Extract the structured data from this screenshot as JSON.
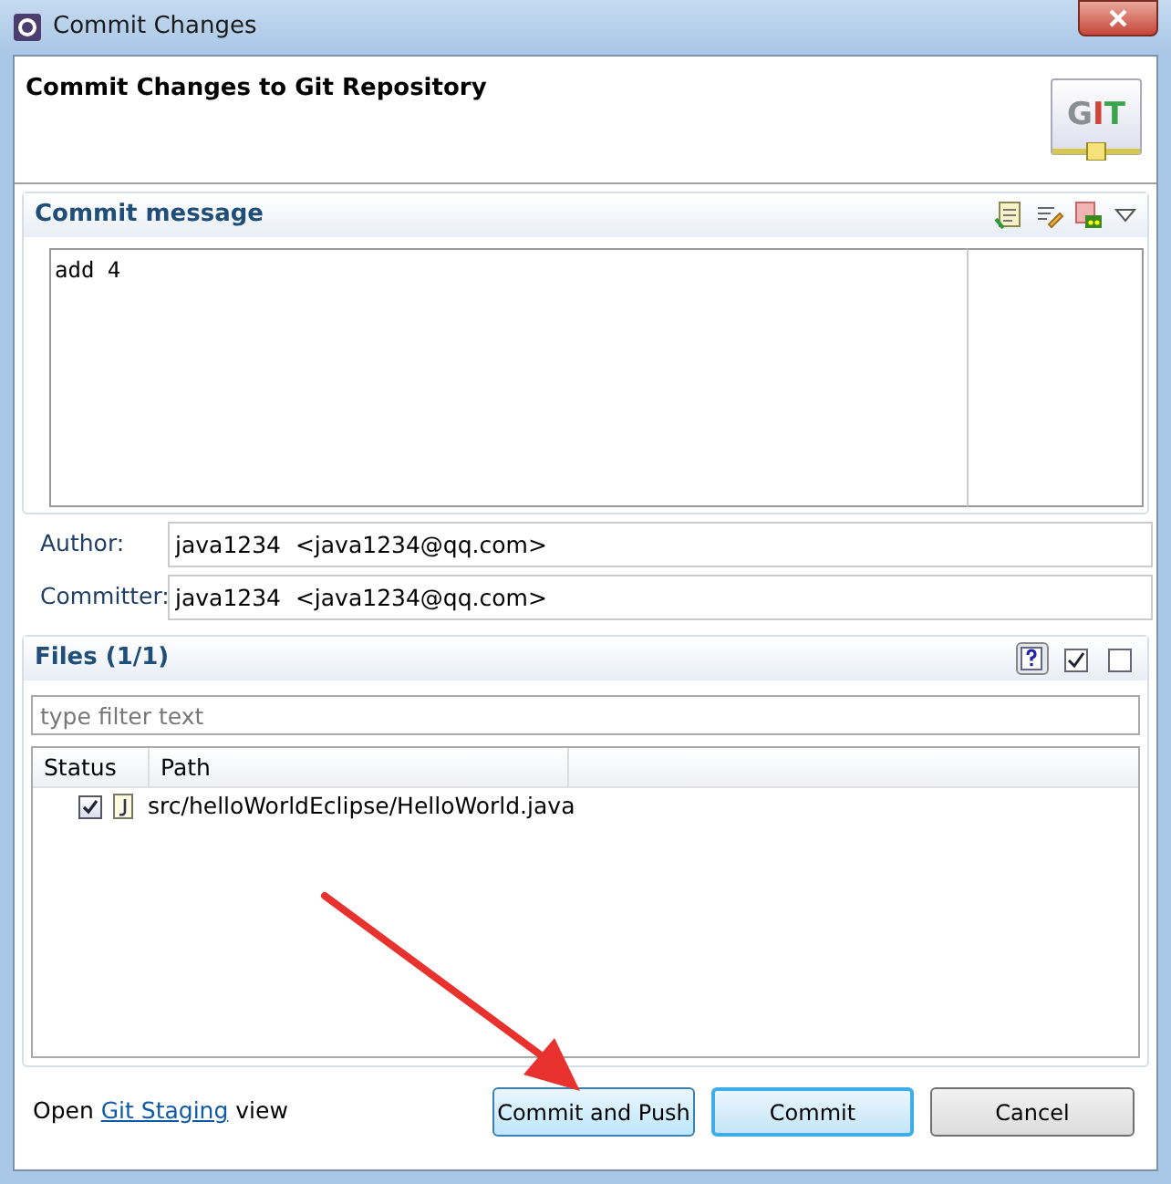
{
  "window": {
    "title": "Commit Changes"
  },
  "header": {
    "title": "Commit Changes to Git Repository",
    "logo_text": "GIT"
  },
  "commit_message": {
    "title": "Commit message",
    "value": "add 4"
  },
  "author": {
    "label": "Author:",
    "value": "java1234  <java1234@qq.com>"
  },
  "committer": {
    "label": "Committer:",
    "value": "java1234  <java1234@qq.com>"
  },
  "files": {
    "title": "Files (1/1)",
    "toolbar": [
      {
        "kind": "untracked",
        "selected": true
      },
      {
        "kind": "check-all",
        "selected": false
      },
      {
        "kind": "uncheck-all",
        "selected": false
      }
    ],
    "filter": {
      "placeholder": "type filter text"
    },
    "columns": [
      "Status",
      "Path"
    ],
    "rows": [
      {
        "checked": true,
        "path": "src/helloWorldEclipse/HelloWorld.java"
      }
    ]
  },
  "footer": {
    "prefix": "Open",
    "link": "Git Staging",
    "suffix": "view"
  },
  "buttons": [
    {
      "label": "Commit and Push",
      "kind": "hover"
    },
    {
      "label": "Commit",
      "kind": "default"
    },
    {
      "label": "Cancel",
      "kind": "normal"
    }
  ]
}
